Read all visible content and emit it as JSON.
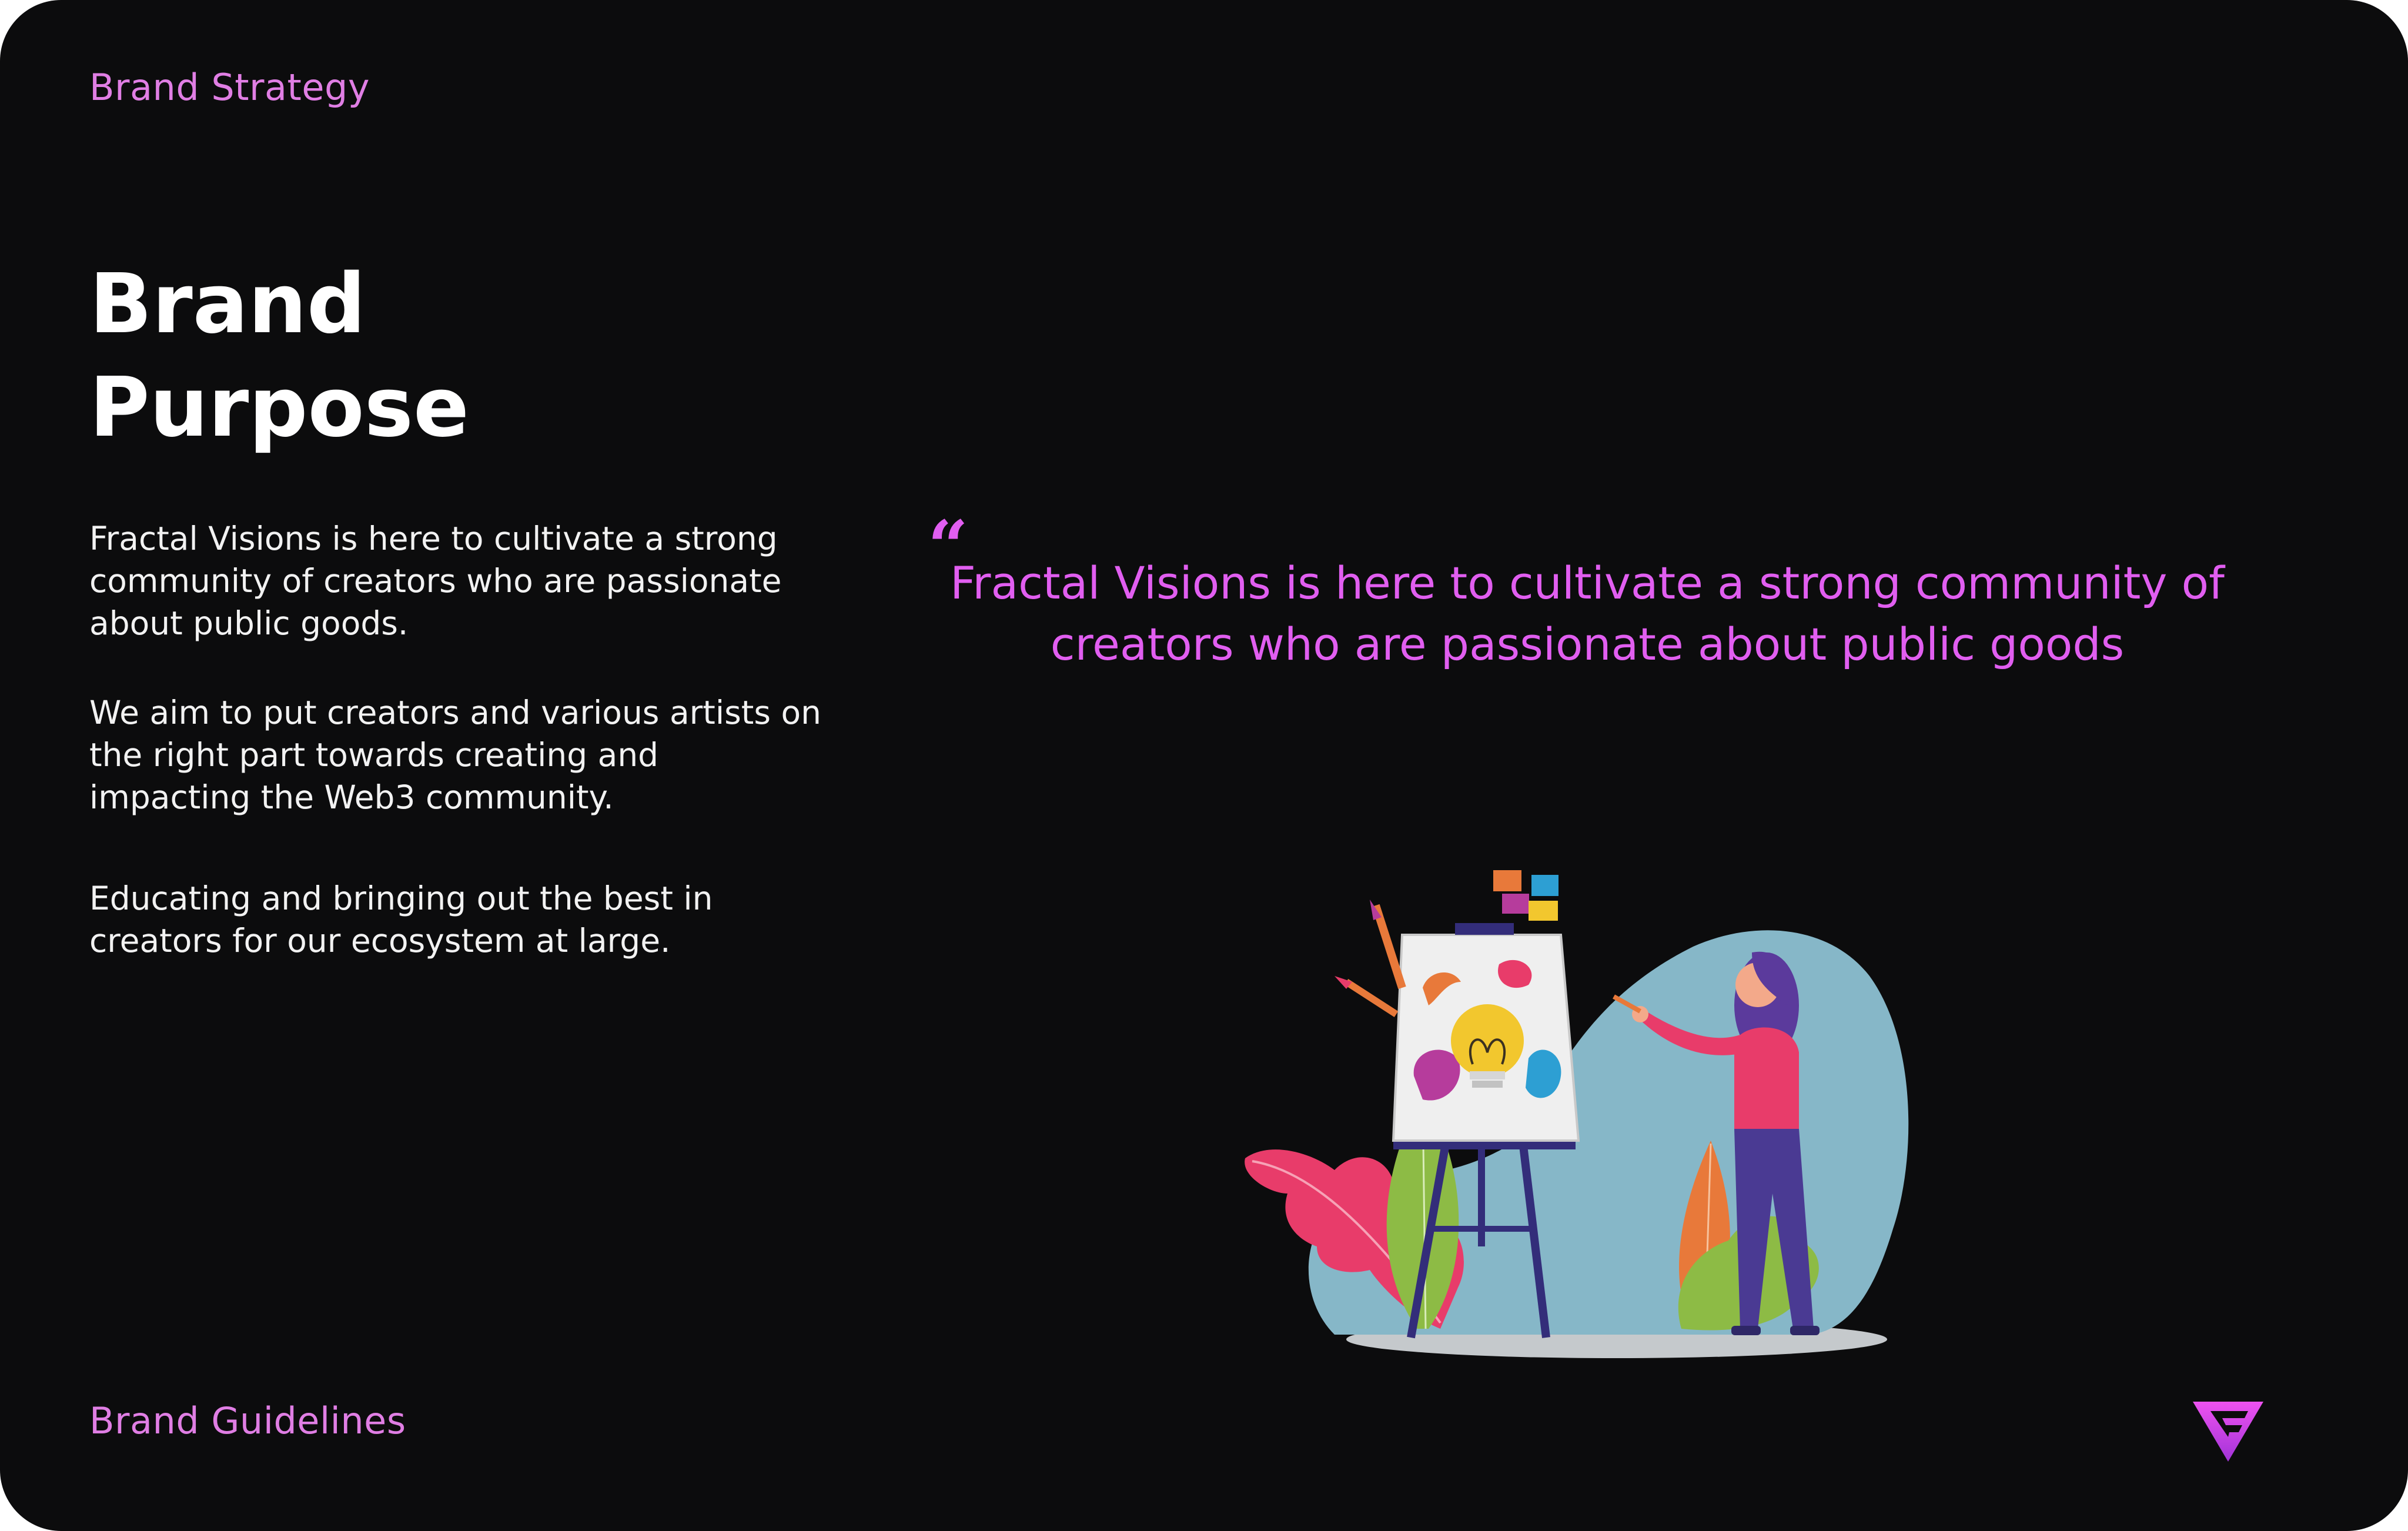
{
  "header": {
    "section_label": "Brand Strategy"
  },
  "title": {
    "line1": "Brand",
    "line2": "Purpose"
  },
  "body": {
    "paragraph1": "Fractal Visions is here to cultivate a strong community of creators who are passionate about public goods.",
    "paragraph2": "We aim to put creators and various artists on the right part towards creating and impacting the Web3 community.",
    "paragraph3": "Educating and bringing out the best in creators for our ecosystem at large."
  },
  "quote": {
    "mark": "“",
    "text": "Fractal Visions is here to cultivate a strong community of creators who are passionate about public goods"
  },
  "footer": {
    "label": "Brand Guidelines"
  },
  "colors": {
    "background": "#0c0c0d",
    "accent": "#e15ef0",
    "label": "#e07ee4",
    "text": "#f2f2f2"
  },
  "icons": {
    "illustration": "artist-painting-lightbulb-illustration",
    "logo": "fractal-visions-logo-icon"
  }
}
